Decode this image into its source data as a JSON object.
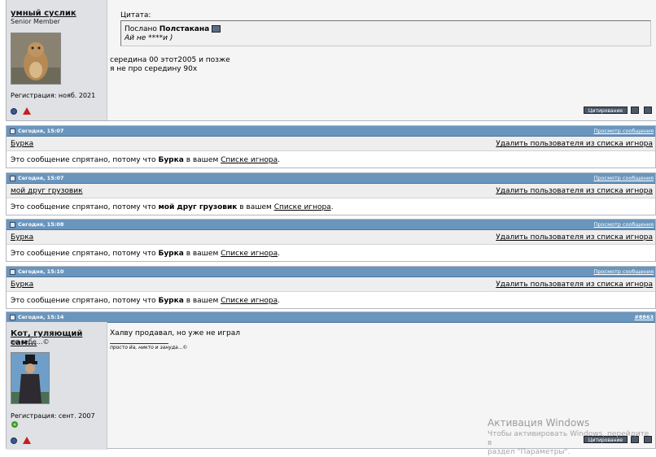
{
  "post_top": {
    "username": "умный суслик",
    "user_title": "Senior Member",
    "registration": "Регистрация: нояб. 2021",
    "quote_label": "Цитата:",
    "quote_prefix": "Послано",
    "quote_author": "Полстакана",
    "quote_text": "Ай не ****и )",
    "message_lines": [
      "середина 00 этот2005 и позже",
      "я не про середину 90х"
    ],
    "quote_button": "Цитирование"
  },
  "hidden_posts": [
    {
      "date": "Сегодня, 15:07",
      "view_link": "Просмотр сообщения",
      "username": "Бурка",
      "remove_link": "Удалить пользователя из списка игнора",
      "msg_prefix": "Это сообщение спрятано, потому что",
      "msg_user": "Бурка",
      "msg_middle": "в вашем",
      "msg_link": "Списке игнора",
      "msg_end": "."
    },
    {
      "date": "Сегодня, 15:07",
      "view_link": "Просмотр сообщения",
      "username": "мой друг грузовик",
      "remove_link": "Удалить пользователя из списка игнора",
      "msg_prefix": "Это сообщение спрятано, потому что",
      "msg_user": "мой друг грузовик",
      "msg_middle": "в вашем",
      "msg_link": "Списке игнора",
      "msg_end": "."
    },
    {
      "date": "Сегодня, 15:08",
      "view_link": "Просмотр сообщения",
      "username": "Бурка",
      "remove_link": "Удалить пользователя из списка игнора",
      "msg_prefix": "Это сообщение спрятано, потому что",
      "msg_user": "Бурка",
      "msg_middle": "в вашем",
      "msg_link": "Списке игнора",
      "msg_end": "."
    },
    {
      "date": "Сегодня, 15:10",
      "view_link": "Просмотр сообщения",
      "username": "Бурка",
      "remove_link": "Удалить пользователя из списка игнора",
      "msg_prefix": "Это сообщение спрятано, потому что",
      "msg_user": "Бурка",
      "msg_middle": "в вашем",
      "msg_link": "Списке игнора",
      "msg_end": "."
    }
  ],
  "post_bottom": {
    "date": "Сегодня, 15:14",
    "post_number": "#8863",
    "username": "Кот, гуляющий сам...",
    "user_title": "по себе...©",
    "registration": "Регистрация: сент. 2007",
    "message": "Халву продавал, но уже не играл",
    "signature": "просто йа, никто и зануда...©",
    "quote_button": "Цитирование"
  },
  "watermark": {
    "title": "Активация Windows",
    "line1": "Чтобы активировать Windows, перейдите в",
    "line2": "раздел \"Параметры\"."
  },
  "colors": {
    "header_bar": "#6a96be",
    "sidebar": "#dfe1e4",
    "warn": "#c81d1d"
  }
}
